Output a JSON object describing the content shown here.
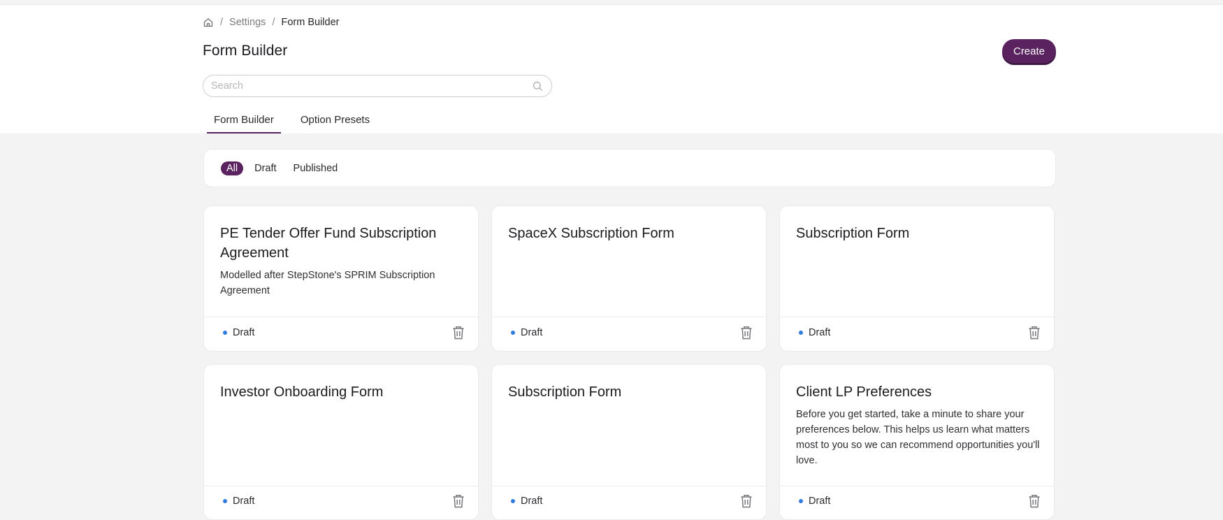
{
  "breadcrumb": {
    "home_icon": "home-icon",
    "separator": "/",
    "items": [
      "Settings",
      "Form Builder"
    ]
  },
  "page": {
    "title": "Form Builder",
    "create_label": "Create"
  },
  "search": {
    "placeholder": "Search",
    "value": "",
    "icon": "search-icon"
  },
  "tabs": [
    {
      "label": "Form Builder",
      "active": true
    },
    {
      "label": "Option Presets",
      "active": false
    }
  ],
  "filters": [
    {
      "label": "All",
      "active": true
    },
    {
      "label": "Draft",
      "active": false
    },
    {
      "label": "Published",
      "active": false
    }
  ],
  "cards": [
    {
      "title": "PE Tender Offer Fund Subscription Agreement",
      "description": "Modelled after StepStone's SPRIM Subscription Agreement",
      "status": "Draft"
    },
    {
      "title": "SpaceX Subscription Form",
      "description": "",
      "status": "Draft"
    },
    {
      "title": "Subscription Form",
      "description": "",
      "status": "Draft"
    },
    {
      "title": "Investor Onboarding Form",
      "description": "",
      "status": "Draft"
    },
    {
      "title": "Subscription Form",
      "description": "",
      "status": "Draft"
    },
    {
      "title": "Client LP Preferences",
      "description": "Before you get started, take a minute to share your preferences below. This helps us learn what matters most to you so we can recommend opportunities you'll love.",
      "status": "Draft"
    }
  ],
  "colors": {
    "accent": "#5a2360",
    "status_dot": "#2f7be0",
    "background": "#f3f3f3"
  }
}
